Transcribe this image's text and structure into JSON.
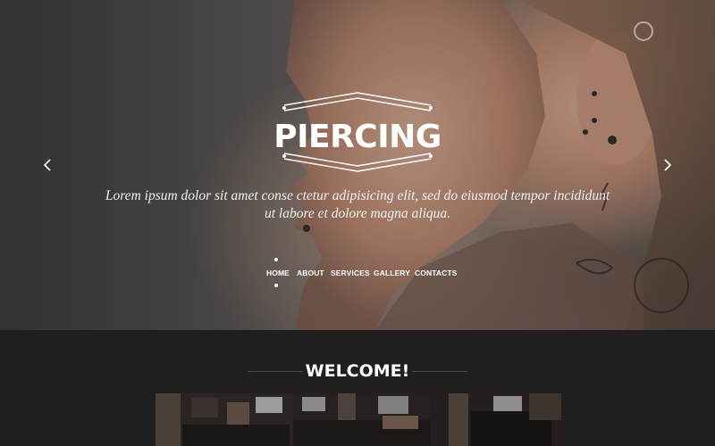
{
  "hero": {
    "logo_text": "PIERCING",
    "tagline": "Lorem ipsum dolor sit amet conse ctetur adipisicing elit, sed do eiusmod tempor incididunt ut labore et dolore magna aliqua."
  },
  "nav": {
    "items": [
      "HOME",
      "ABOUT",
      "SERVICES",
      "GALLERY",
      "CONTACTS"
    ],
    "active": "HOME"
  },
  "welcome": {
    "title": "WELCOME!"
  },
  "icons": {
    "prev": "chevron-left-icon",
    "next": "chevron-right-icon"
  },
  "colors": {
    "dark_bg": "#1f1f1f",
    "text": "#ffffff",
    "rule": "#4a4a4a"
  }
}
